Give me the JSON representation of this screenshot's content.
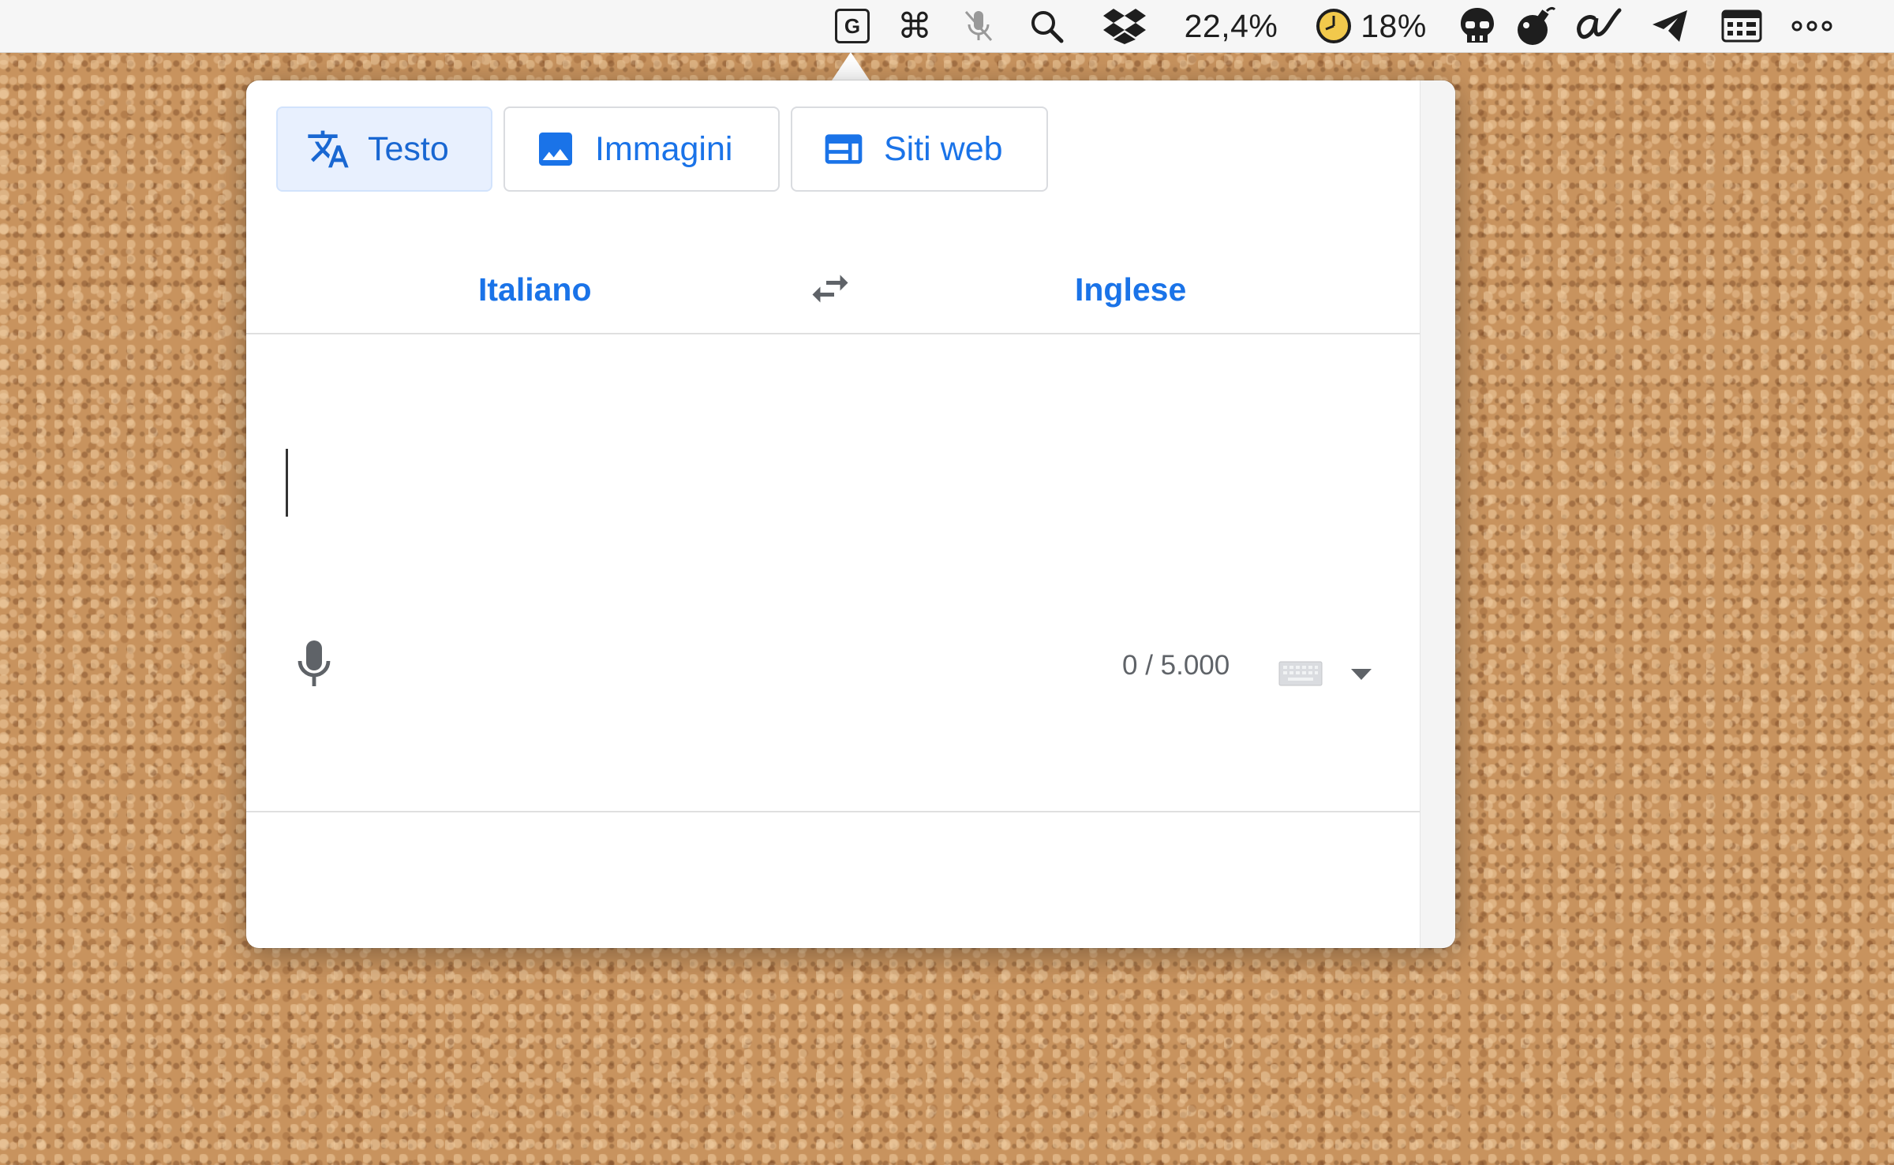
{
  "menubar": {
    "translate_icon_text": "G",
    "command_glyph": "⌘",
    "cpu_percent": "22,4%",
    "timer_percent": "18%",
    "more_glyph": "⋯",
    "items": [
      "google-translate-icon",
      "command-icon",
      "mic-muted-icon",
      "search-icon",
      "dropbox-icon",
      "cpu-readout",
      "timer-icon",
      "skull-icon",
      "bomb-icon",
      "signature-icon",
      "telegram-icon",
      "keyboard-grid-icon",
      "more-icon"
    ]
  },
  "popover": {
    "modes": [
      {
        "label": "Testo",
        "icon": "translate-icon",
        "active": true
      },
      {
        "label": "Immagini",
        "icon": "image-icon",
        "active": false
      },
      {
        "label": "Siti web",
        "icon": "website-icon",
        "active": false
      }
    ],
    "source_language": "Italiano",
    "target_language": "Inglese",
    "input_value": "",
    "char_counter": "0 / 5.000"
  },
  "colors": {
    "accent": "#1a73e8",
    "active_bg": "#e8f0fe",
    "muted": "#5f6368",
    "menubar_bg": "#f6f6f6"
  }
}
